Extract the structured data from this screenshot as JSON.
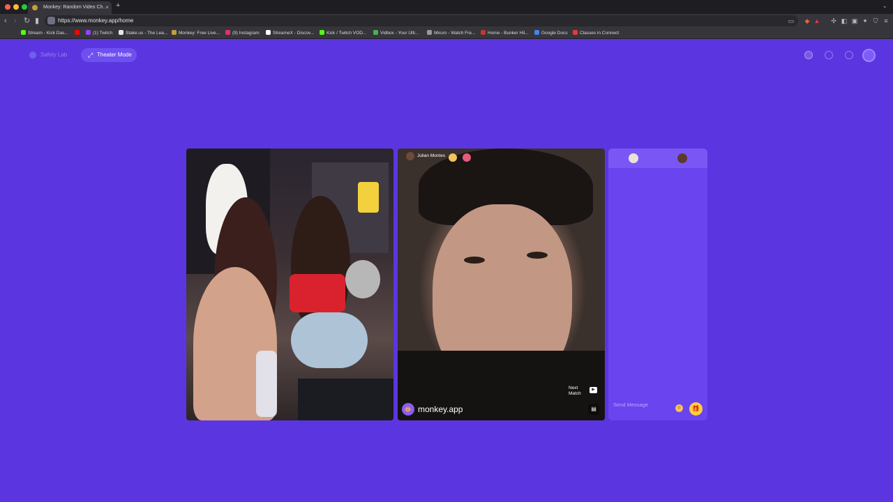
{
  "browser": {
    "tab_title": "Monkey: Random Video Ch...",
    "new_tab_glyph": "+",
    "close_glyph": "×",
    "url": "https://www.monkey.app/home",
    "bookmarks": [
      {
        "label": "Stream - Kick Das...",
        "color": "#53fc18"
      },
      {
        "label": "",
        "color": "#ff0000"
      },
      {
        "label": "(1) Twitch",
        "color": "#9146ff"
      },
      {
        "label": "Stake.us - The Lea...",
        "color": "#e6e6e6"
      },
      {
        "label": "Monkey: Free Live...",
        "color": "#c89b3c"
      },
      {
        "label": "(9) Instagram",
        "color": "#e1306c"
      },
      {
        "label": "StreameX - Discov...",
        "color": "#ffffff"
      },
      {
        "label": "Kick / Twitch VOD...",
        "color": "#53fc18"
      },
      {
        "label": "Vidbox - Your Ulti...",
        "color": "#4caf50"
      },
      {
        "label": "Miruro - Watch Fre...",
        "color": "#999999"
      },
      {
        "label": "Home - Bunker Hil...",
        "color": "#c0392b"
      },
      {
        "label": "Google Docs",
        "color": "#4285f4"
      },
      {
        "label": "Classes in Connect",
        "color": "#e53935"
      }
    ]
  },
  "app": {
    "safety_lab_label": "Safety Lab",
    "theater_mode_label": "Theater Mode",
    "theater_icon": "⤢",
    "remote_user_name": "Julian Montes",
    "brand_label": "monkey.app",
    "brand_icon": "🐵",
    "next_match_line1": "Next",
    "next_match_line2": "Match",
    "next_icon": "▶",
    "chat_toggle_icon": "▤",
    "message_placeholder": "Send Message",
    "emoji_icon": "☺",
    "gift_icon": "🎁",
    "accent_color": "#5b36e0"
  }
}
